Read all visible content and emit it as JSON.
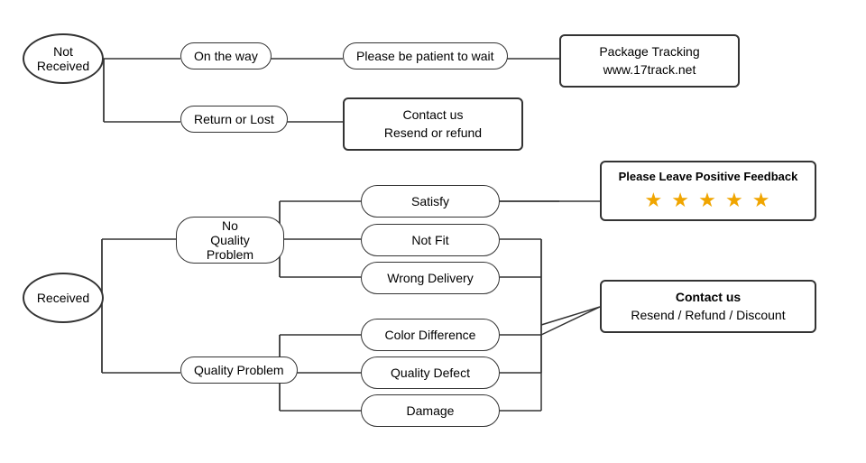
{
  "nodes": {
    "not_received": "Not\nReceived",
    "received": "Received",
    "on_the_way": "On the way",
    "return_or_lost": "Return or Lost",
    "patient": "Please be patient to wait",
    "package_tracking": "Package Tracking\nwww.17track.net",
    "contact_resend_refund": "Contact us\nResend or refund",
    "no_quality_problem": "No\nQuality Problem",
    "quality_problem": "Quality Problem",
    "satisfy": "Satisfy",
    "not_fit": "Not Fit",
    "wrong_delivery": "Wrong Delivery",
    "color_difference": "Color Difference",
    "quality_defect": "Quality Defect",
    "damage": "Damage",
    "positive_feedback_title": "Please Leave Positive Feedback",
    "positive_feedback_stars": "★ ★ ★ ★ ★",
    "contact_us_label": "Contact us",
    "resend_refund_discount": "Resend / Refund / Discount"
  }
}
